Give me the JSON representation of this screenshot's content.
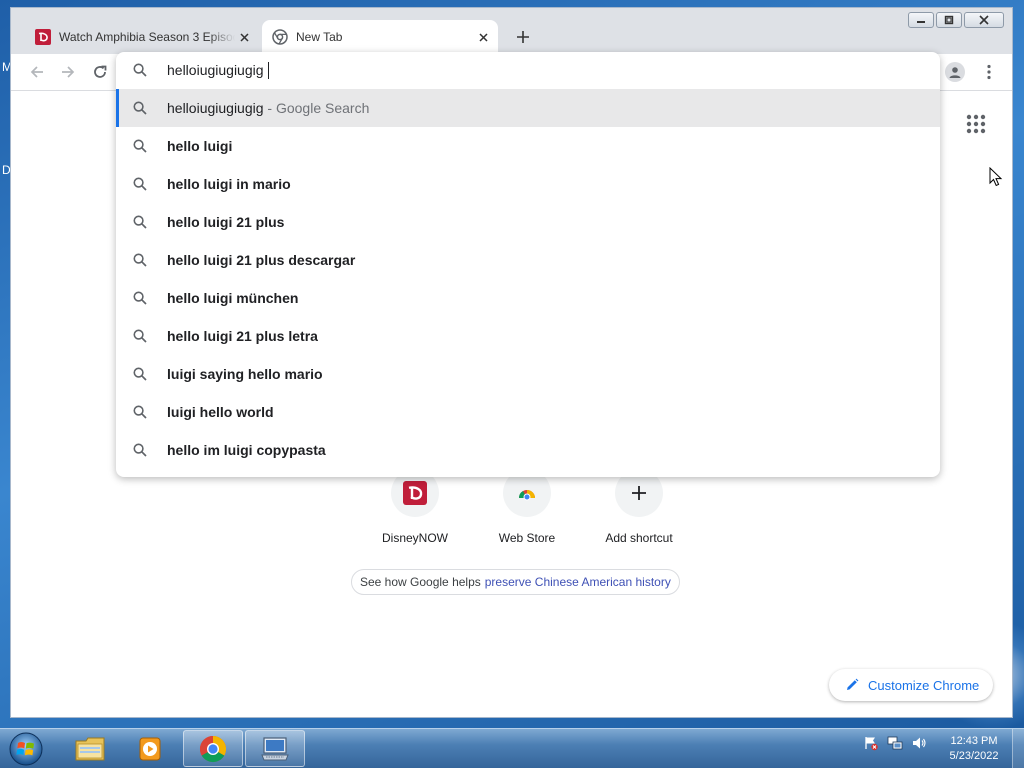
{
  "desktop": {
    "edge_letters": [
      "M",
      "D"
    ]
  },
  "window": {
    "controls": {
      "minimize": "minimize",
      "maximize": "maximize",
      "close": "close"
    }
  },
  "tabs": [
    {
      "title": "Watch Amphibia Season 3 Episod",
      "icon": "disney-icon",
      "active": false
    },
    {
      "title": "New Tab",
      "icon": "chrome-icon",
      "active": true
    }
  ],
  "omnibox": {
    "value": "helloiugiugiugig",
    "suggestions": [
      {
        "text": "helloiugiugiugig",
        "desc": "- Google Search",
        "selected": true
      },
      {
        "text": "hello luigi"
      },
      {
        "text": "hello luigi in mario"
      },
      {
        "text": "hello luigi 21 plus"
      },
      {
        "text": "hello luigi 21 plus descargar"
      },
      {
        "text": "hello luigi münchen"
      },
      {
        "text": "hello luigi 21 plus letra"
      },
      {
        "text": "luigi saying hello mario"
      },
      {
        "text": "luigi hello world"
      },
      {
        "text": "hello im luigi copypasta"
      }
    ]
  },
  "ntp": {
    "shortcuts": [
      {
        "label": "DisneyNOW",
        "icon": "disney-icon"
      },
      {
        "label": "Web Store",
        "icon": "web-store-icon"
      },
      {
        "label": "Add shortcut",
        "icon": "plus-icon"
      }
    ],
    "promo": {
      "text": "See how Google helps",
      "link": "preserve Chinese American history"
    },
    "customize_label": "Customize Chrome"
  },
  "taskbar": {
    "apps": [
      "file-explorer",
      "media-player",
      "chrome",
      "remote-desktop"
    ],
    "clock": {
      "time": "12:43 PM",
      "date": "5/23/2022"
    }
  },
  "colors": {
    "accent": "#1a73e8",
    "disney_red": "#c01e3a",
    "tab_strip": "#dee1e6",
    "promo_link": "#3f51b5"
  }
}
